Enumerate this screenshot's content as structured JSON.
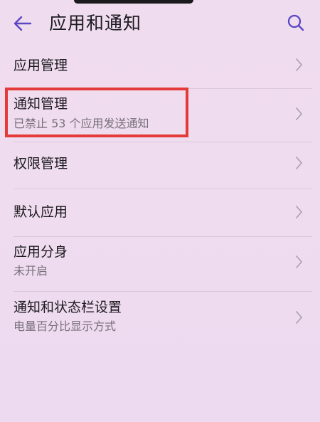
{
  "header": {
    "title": "应用和通知",
    "back_icon": "arrow-left-icon",
    "search_icon": "search-icon"
  },
  "items": [
    {
      "title": "应用管理"
    },
    {
      "title": "通知管理",
      "subtitle": "已禁止 53 个应用发送通知"
    },
    {
      "title": "权限管理"
    },
    {
      "title": "默认应用"
    },
    {
      "title": "应用分身",
      "subtitle": "未开启"
    },
    {
      "title": "通知和状态栏设置",
      "subtitle": "电量百分比显示方式"
    }
  ],
  "colors": {
    "accent": "#5c46c4",
    "highlight": "#e53a3a",
    "background": "#efdcee",
    "subtitle": "#77707a"
  }
}
